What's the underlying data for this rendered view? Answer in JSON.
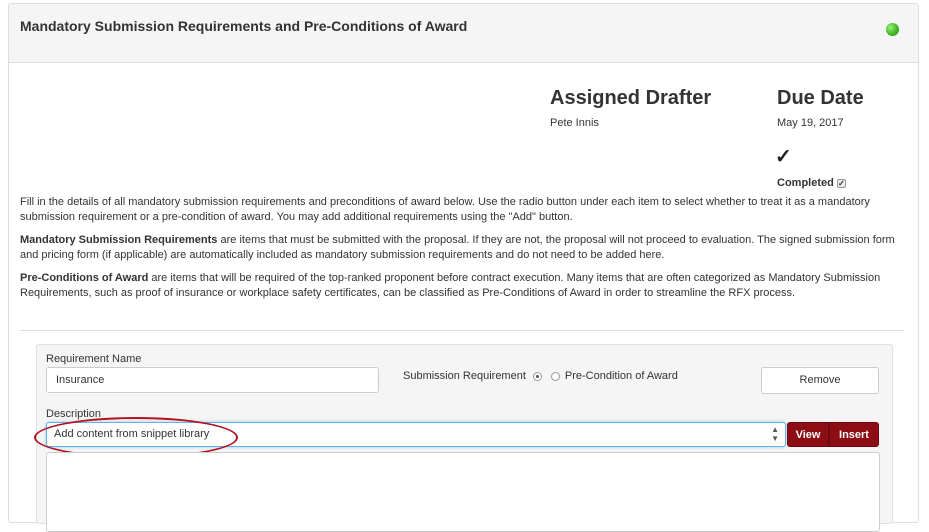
{
  "panel": {
    "title": "Mandatory Submission Requirements and Pre-Conditions of Award",
    "status_color": "#3cb521"
  },
  "assignment": {
    "drafter_heading": "Assigned Drafter",
    "drafter_name": "Pete Innis",
    "due_heading": "Due Date",
    "due_date": "May 19, 2017",
    "checkmark": "✓",
    "completed_label": "Completed",
    "completed_checked": true
  },
  "instructions": {
    "intro": "Fill in the details of all mandatory submission requirements and preconditions of award below. Use the radio button under each item to select whether to treat it as a mandatory submission requirement or a pre-condition of award. You may add additional requirements using the \"Add\" button.",
    "msr_term": "Mandatory Submission Requirements",
    "msr_text": " are items that must be submitted with the proposal. If they are not, the proposal will not proceed to evaluation. The signed submission form and pricing form (if applicable) are automatically included as mandatory submission requirements and do not need to be added here.",
    "pca_term": "Pre-Conditions of Award",
    "pca_text": " are items that will be required of the top-ranked proponent before contract execution. Many items that are often categorized as Mandatory Submission Requirements, such as proof of insurance or workplace safety certificates, can be classified as Pre-Conditions of Award in order to streamline the RFX process."
  },
  "requirement": {
    "name_label": "Requirement Name",
    "name_value": "Insurance",
    "radio_submission": "Submission Requirement",
    "radio_precondition": "Pre-Condition of Award",
    "selected": "submission",
    "remove_label": "Remove",
    "description_label": "Description",
    "snippet_select": "Add content from snippet library",
    "view_label": "View",
    "insert_label": "Insert",
    "accent_color": "#8c0e14"
  }
}
